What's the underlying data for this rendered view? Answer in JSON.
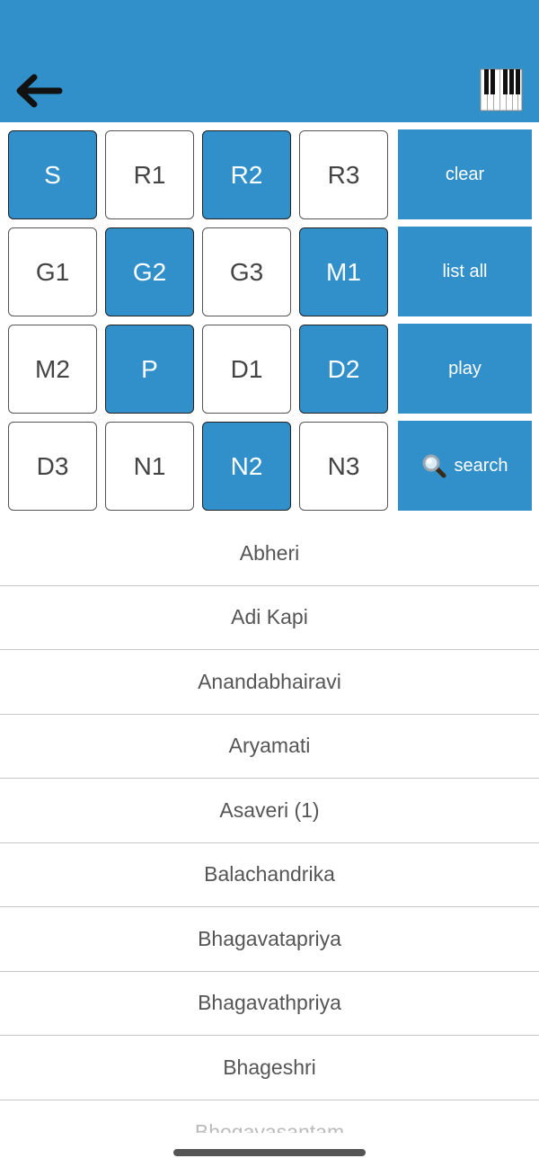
{
  "header": {
    "back_icon": "arrow-left-icon",
    "piano_icon": "piano-keyboard-icon",
    "accent_color": "#318fc9"
  },
  "swaras": [
    {
      "label": "S",
      "selected": true
    },
    {
      "label": "R1",
      "selected": false
    },
    {
      "label": "R2",
      "selected": true
    },
    {
      "label": "R3",
      "selected": false
    },
    {
      "label": "G1",
      "selected": false
    },
    {
      "label": "G2",
      "selected": true
    },
    {
      "label": "G3",
      "selected": false
    },
    {
      "label": "M1",
      "selected": true
    },
    {
      "label": "M2",
      "selected": false
    },
    {
      "label": "P",
      "selected": true
    },
    {
      "label": "D1",
      "selected": false
    },
    {
      "label": "D2",
      "selected": true
    },
    {
      "label": "D3",
      "selected": false
    },
    {
      "label": "N1",
      "selected": false
    },
    {
      "label": "N2",
      "selected": true
    },
    {
      "label": "N3",
      "selected": false
    }
  ],
  "actions": {
    "clear": "clear",
    "list_all": "list all",
    "play": "play",
    "search": "search",
    "search_icon": "magnifier-icon"
  },
  "ragas": [
    "Abheri",
    "Adi Kapi",
    "Anandabhairavi",
    "Aryamati",
    "Asaveri (1)",
    "Balachandrika",
    "Bhagavatapriya",
    "Bhagavathpriya",
    "Bhageshri",
    "Bhogavasantam"
  ]
}
